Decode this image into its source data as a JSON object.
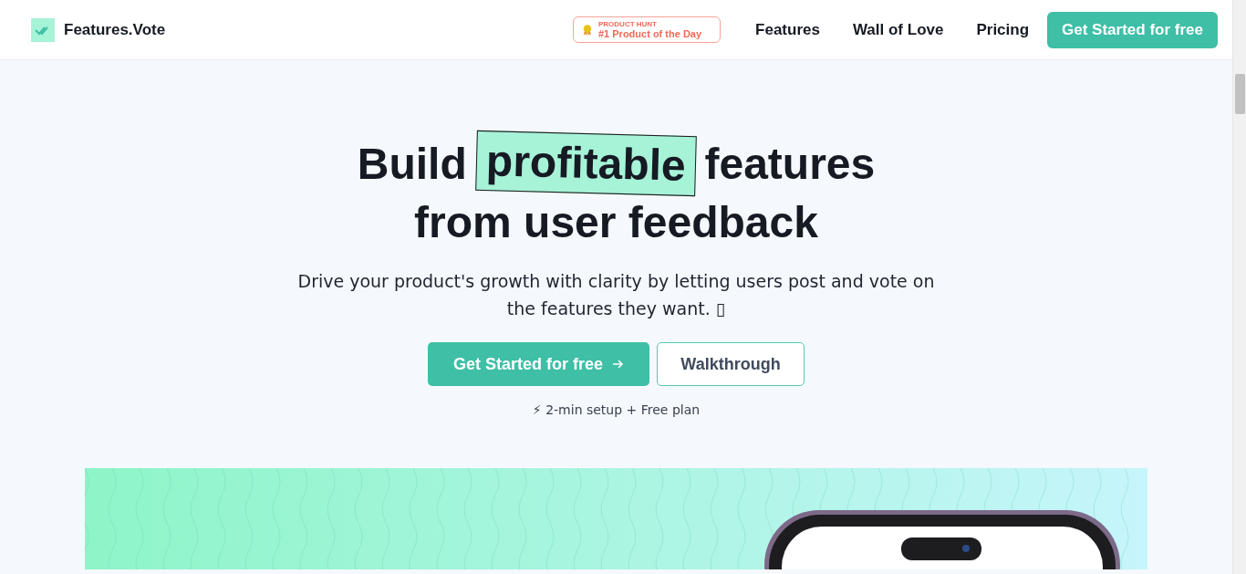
{
  "header": {
    "logo": "Features.Vote",
    "badge": {
      "eyebrow": "PRODUCT HUNT",
      "text": "#1 Product of the Day"
    },
    "nav": [
      "Features",
      "Wall of Love",
      "Pricing"
    ],
    "cta": "Get Started for free"
  },
  "hero": {
    "headline": {
      "before": "Build",
      "highlight": "profitable",
      "after": "features",
      "line2": "from user feedback"
    },
    "subtitle": "Drive your product's growth with clarity by letting users post and vote on the features they want. ▯",
    "buttons": [
      {
        "kind": "primary",
        "label": "Get Started for free"
      },
      {
        "kind": "outline",
        "label": "Walkthrough"
      }
    ],
    "note": "⚡ 2-min setup + Free plan"
  }
}
